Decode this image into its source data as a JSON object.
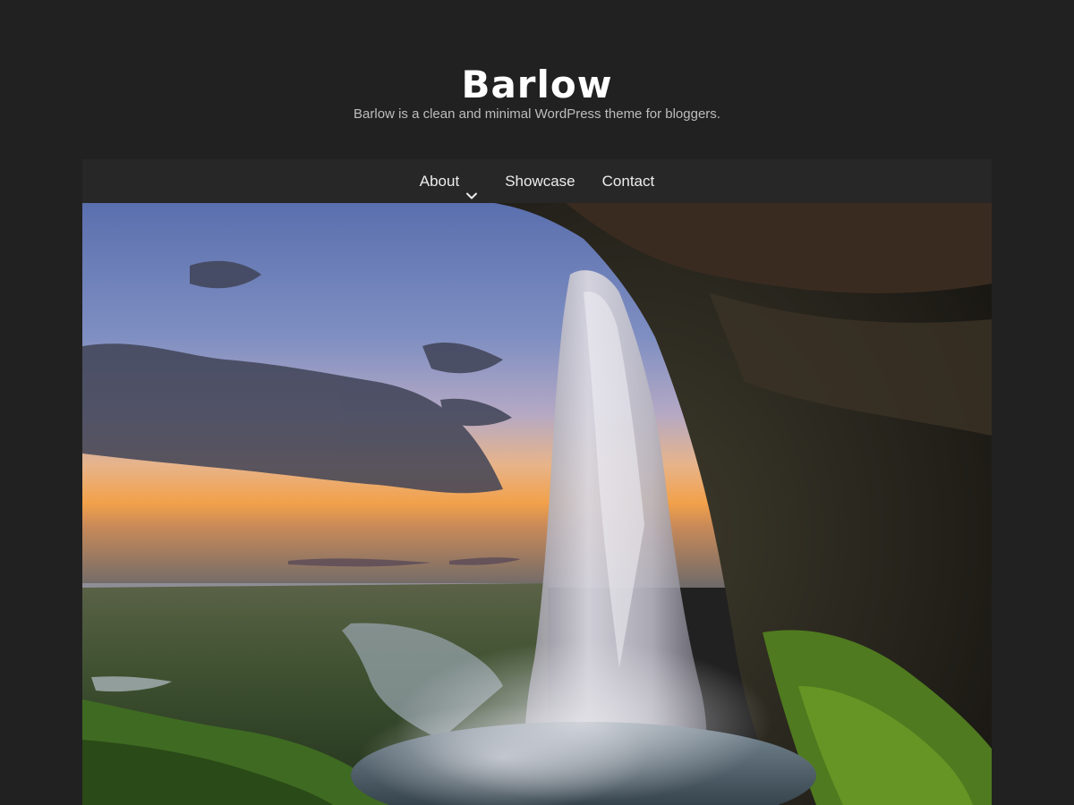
{
  "site": {
    "title": "Barlow",
    "tagline": "Barlow is a clean and minimal WordPress theme for bloggers."
  },
  "nav": {
    "items": [
      {
        "label": "About",
        "has_submenu": true,
        "icon": "chevron-down-icon"
      },
      {
        "label": "Showcase",
        "has_submenu": false
      },
      {
        "label": "Contact",
        "has_submenu": false
      }
    ]
  },
  "hero": {
    "subject": "waterfall"
  },
  "colors": {
    "background": "#212121",
    "nav_background": "#272727",
    "title": "#ffffff",
    "tagline": "#bdbdbd"
  }
}
